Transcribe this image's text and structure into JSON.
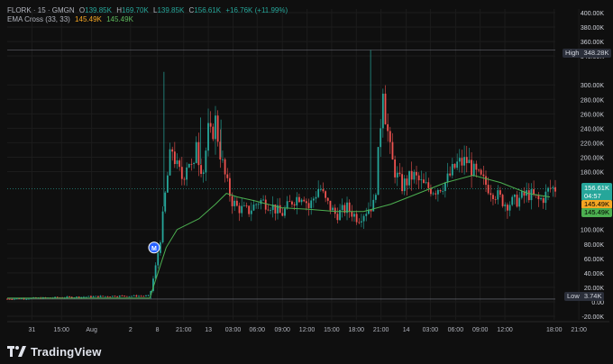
{
  "header": {
    "symbol": "FLORK · 15 · GMGN",
    "open_label": "O",
    "open": "139.85K",
    "high_label": "H",
    "high": "169.70K",
    "low_label": "L",
    "low": "139.85K",
    "close_label": "C",
    "close": "156.61K",
    "change": "+16.76K (+11.99%)",
    "indicator_name": "EMA Cross (33, 33)",
    "ema1": "145.49K",
    "ema2": "145.49K"
  },
  "badges": {
    "high_label": "High",
    "high_value": "348.28K",
    "low_label": "Low",
    "low_value": "3.74K",
    "price": "156.61K",
    "countdown": "04:57",
    "ema1": "145.49K",
    "ema2": "145.49K"
  },
  "footer": {
    "brand": "TradingView",
    "logo": "tradingview-logo-icon"
  },
  "colors": {
    "up": "#26a69a",
    "down": "#ef5350",
    "ema": "#4caf50",
    "ema_alt": "#f5a623",
    "background": "#0f0f0f",
    "grid": "#1e1e1e"
  },
  "chart_data": {
    "type": "candlestick",
    "y_ticks": [
      "400.00K",
      "380.00K",
      "360.00K",
      "340.00K",
      "300.00K",
      "280.00K",
      "260.00K",
      "240.00K",
      "220.00K",
      "200.00K",
      "180.00K",
      "100.00K",
      "80.00K",
      "60.00K",
      "40.00K",
      "20.00K",
      "0.00",
      "-20.00K"
    ],
    "y_tick_values": [
      400,
      380,
      360,
      340,
      300,
      280,
      260,
      240,
      220,
      200,
      180,
      100,
      80,
      60,
      40,
      20,
      0,
      -20
    ],
    "ylim": [
      -25,
      405
    ],
    "x_ticks": [
      "31",
      "15:00",
      "Aug",
      "2",
      "8",
      "21:00",
      "13",
      "03:00",
      "06:00",
      "09:00",
      "12:00",
      "15:00",
      "18:00",
      "21:00",
      "14",
      "03:00",
      "06:00",
      "09:00",
      "12:00",
      "18:00",
      "21:00"
    ],
    "x_tick_positions": [
      0.045,
      0.099,
      0.154,
      0.225,
      0.274,
      0.322,
      0.367,
      0.412,
      0.456,
      0.502,
      0.547,
      0.592,
      0.637,
      0.682,
      0.728,
      0.772,
      0.818,
      0.863,
      0.908,
      0.998,
      1.043
    ],
    "high_line": 348.28,
    "low_line": 3.74,
    "current_price": 156.61,
    "ema_level": 145.49,
    "series": [
      {
        "name": "EMA",
        "path": [
          [
            0.0,
            5
          ],
          [
            0.26,
            5
          ],
          [
            0.275,
            40
          ],
          [
            0.29,
            75
          ],
          [
            0.31,
            100
          ],
          [
            0.35,
            115
          ],
          [
            0.38,
            135
          ],
          [
            0.4,
            150
          ],
          [
            0.42,
            145
          ],
          [
            0.45,
            140
          ],
          [
            0.5,
            130
          ],
          [
            0.55,
            128
          ],
          [
            0.6,
            125
          ],
          [
            0.65,
            125
          ],
          [
            0.7,
            135
          ],
          [
            0.75,
            150
          ],
          [
            0.8,
            165
          ],
          [
            0.85,
            175
          ],
          [
            0.9,
            165
          ],
          [
            0.95,
            150
          ],
          [
            0.99,
            145
          ]
        ]
      }
    ],
    "candles_outline": [
      [
        0.0,
        4
      ],
      [
        0.1,
        6
      ],
      [
        0.15,
        7
      ],
      [
        0.2,
        8
      ],
      [
        0.26,
        8
      ],
      [
        0.27,
        45
      ],
      [
        0.28,
        90
      ],
      [
        0.29,
        160
      ],
      [
        0.3,
        215
      ],
      [
        0.31,
        185
      ],
      [
        0.32,
        170
      ],
      [
        0.33,
        200
      ],
      [
        0.34,
        175
      ],
      [
        0.345,
        230
      ],
      [
        0.35,
        195
      ],
      [
        0.36,
        180
      ],
      [
        0.365,
        240
      ],
      [
        0.37,
        225
      ],
      [
        0.38,
        250
      ],
      [
        0.39,
        200
      ],
      [
        0.4,
        165
      ],
      [
        0.41,
        140
      ],
      [
        0.42,
        130
      ],
      [
        0.44,
        125
      ],
      [
        0.46,
        140
      ],
      [
        0.48,
        135
      ],
      [
        0.5,
        120
      ],
      [
        0.52,
        140
      ],
      [
        0.54,
        150
      ],
      [
        0.55,
        130
      ],
      [
        0.57,
        160
      ],
      [
        0.58,
        140
      ],
      [
        0.6,
        120
      ],
      [
        0.62,
        130
      ],
      [
        0.64,
        115
      ],
      [
        0.66,
        130
      ],
      [
        0.67,
        135
      ],
      [
        0.68,
        230
      ],
      [
        0.685,
        310
      ],
      [
        0.69,
        260
      ],
      [
        0.7,
        200
      ],
      [
        0.71,
        175
      ],
      [
        0.72,
        160
      ],
      [
        0.74,
        175
      ],
      [
        0.76,
        160
      ],
      [
        0.78,
        155
      ],
      [
        0.8,
        165
      ],
      [
        0.82,
        190
      ],
      [
        0.84,
        195
      ],
      [
        0.85,
        180
      ],
      [
        0.87,
        165
      ],
      [
        0.89,
        150
      ],
      [
        0.91,
        135
      ],
      [
        0.93,
        140
      ],
      [
        0.95,
        150
      ],
      [
        0.97,
        140
      ],
      [
        0.98,
        145
      ],
      [
        0.99,
        157
      ]
    ]
  }
}
